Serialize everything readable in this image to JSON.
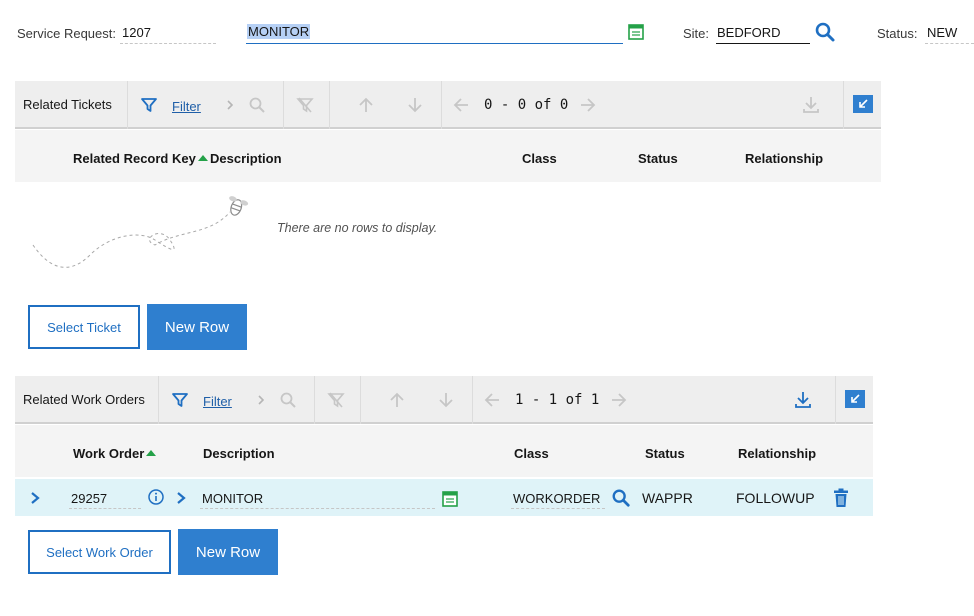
{
  "header": {
    "service_request_label": "Service Request:",
    "service_request_value": "1207",
    "description_value": "MONITOR",
    "site_label": "Site:",
    "site_value": "BEDFORD",
    "status_label": "Status:",
    "status_value": "NEW"
  },
  "related_tickets": {
    "title": "Related Tickets",
    "filter_label": "Filter",
    "pager": "0 - 0 of 0",
    "columns": [
      "Related Record Key",
      "Description",
      "Class",
      "Status",
      "Relationship"
    ],
    "empty_message": "There are no rows to display.",
    "select_button": "Select Ticket",
    "new_row_button": "New Row"
  },
  "related_work_orders": {
    "title": "Related Work Orders",
    "filter_label": "Filter",
    "pager": "1 - 1 of 1",
    "columns": [
      "Work Order",
      "Description",
      "Class",
      "Status",
      "Relationship"
    ],
    "rows": [
      {
        "work_order": "29257",
        "description": "MONITOR",
        "class": "WORKORDER",
        "status": "WAPPR",
        "relationship": "FOLLOWUP"
      }
    ],
    "select_button": "Select Work Order",
    "new_row_button": "New Row"
  },
  "colors": {
    "accent": "#2f7fcf",
    "link": "#1f5fa8",
    "sort_indicator": "#24a148",
    "row_highlight": "#dff3f8"
  }
}
